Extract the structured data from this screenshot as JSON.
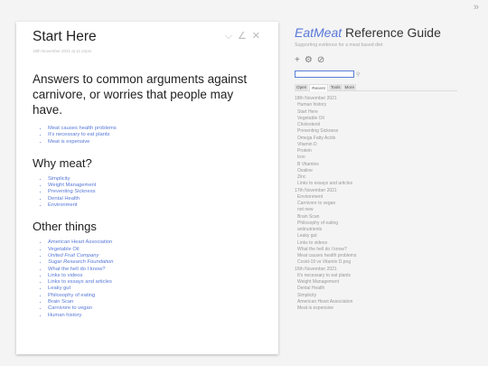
{
  "corner_toggle": "»",
  "tiddler": {
    "title": "Start Here",
    "subtitle": "18th November 2021 at 11:24pm",
    "controls": [
      "⌵",
      "∠",
      "✕"
    ],
    "lead": "Answers to common arguments against carnivore, or worries that people may have.",
    "intro_list": [
      "Meat causes health problems",
      "It's necessary to eat plants",
      "Meat is expensive"
    ],
    "why_heading": "Why meat?",
    "why_list": [
      "Simplicity",
      "Weight Management",
      "Preventing Sickness",
      "Dental Health",
      "Environment"
    ],
    "other_heading": "Other things",
    "other_list": [
      {
        "text": "American Heart Association",
        "italic": false
      },
      {
        "text": "Vegetable Oil",
        "italic": false
      },
      {
        "text": "United Fruit Company",
        "italic": true
      },
      {
        "text": "Sugar Research Foundation",
        "italic": true
      },
      {
        "text": "What the hell do I know?",
        "italic": false
      },
      {
        "text": "Links to videos",
        "italic": false
      },
      {
        "text": "Links to essays and articles",
        "italic": false
      },
      {
        "text": "Leaky gut",
        "italic": false
      },
      {
        "text": "Philosophy of eating",
        "italic": false
      },
      {
        "text": "Brain Scan",
        "italic": false
      },
      {
        "text": "Carnivore to vegan",
        "italic": false
      },
      {
        "text": "Human history",
        "italic": false
      }
    ]
  },
  "sidebar": {
    "brand": "EatMeat",
    "title_rest": " Reference Guide",
    "subtitle": "Supporting evidence for a meat based diet",
    "tool_icons": [
      "+",
      "⚙",
      "⊘"
    ],
    "search": {
      "value": "",
      "icon": "⚲"
    },
    "tabs": [
      "Open",
      "Recent",
      "Tools",
      "More"
    ],
    "active_tab": "Recent",
    "recent": [
      {
        "date": "18th November 2021",
        "items": [
          "Human history",
          "Start Here",
          "Vegetable Oil",
          "Cholesterol",
          "Preventing Sickness",
          "Omega Fatty Acids",
          "Vitamin D",
          "Protein",
          "Iron",
          "B Vitamins",
          "Oxaline",
          "Zinc",
          "Links to essays and articles"
        ]
      },
      {
        "date": "17th November 2021",
        "items": [
          "Environment",
          "Carnivore to vegan",
          "not new",
          "Brain Scan",
          "Philosophy of eating",
          "antinutrients",
          "Leaky gut",
          "Links to videos",
          "What the hell do I know?",
          "Meat causes health problems",
          "Covid-19 vs Vitamin D.png"
        ]
      },
      {
        "date": "16th November 2021",
        "items": [
          "It's necessary to eat plants",
          "Weight Management",
          "Dental Health",
          "Simplicity",
          "American Heart Association",
          "Meat is expensive"
        ]
      }
    ]
  }
}
